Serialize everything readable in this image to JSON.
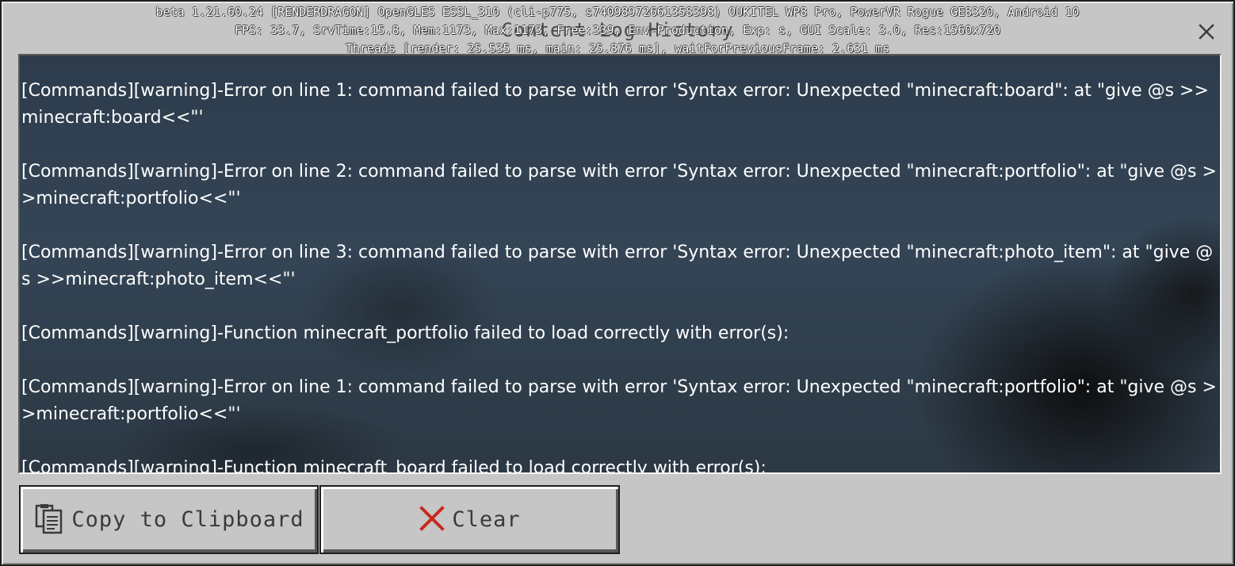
{
  "dialog": {
    "title": "Content Log History",
    "close_icon": "close-icon"
  },
  "debug_overlay": {
    "line1": "beta 1.21.60.24 [RENDERDRAGON] OpenGLES ESSL_310 (cli-p775, s74098972661358398) OUKITEL WP8 Pro, PowerVR Rogue GE8320, Android 10",
    "line2": "FPS: 33.7, SrvTime:15.8, Mem:1173, Max:1173, Free:339, Env-Production, Exp: s, GUI Scale: 3.0, Res:1560x720",
    "line3": "Threads [render: 25.535 ms, main: 25.876 ms], waitForPreviousFrame: 2.631 ms"
  },
  "log": {
    "entries": [
      "[Commands][warning]-Error on line 1: command failed to parse with error 'Syntax error: Unexpected \"minecraft:board\": at \"give @s >>minecraft:board<<\"'",
      "[Commands][warning]-Error on line 2: command failed to parse with error 'Syntax error: Unexpected \"minecraft:portfolio\": at \"give @s >>minecraft:portfolio<<\"'",
      "[Commands][warning]-Error on line 3: command failed to parse with error 'Syntax error: Unexpected \"minecraft:photo_item\": at \"give @s >>minecraft:photo_item<<\"'",
      "[Commands][warning]-Function minecraft_portfolio failed to load correctly with error(s):",
      "[Commands][warning]-Error on line 1: command failed to parse with error 'Syntax error: Unexpected \"minecraft:portfolio\": at \"give @s >>minecraft:portfolio<<\"'",
      "[Commands][warning]-Function minecraft_board failed to load correctly with error(s):"
    ]
  },
  "buttons": {
    "copy_label": "Copy to Clipboard",
    "copy_icon": "clipboard-icon",
    "clear_label": "Clear",
    "clear_icon": "x-icon",
    "clear_icon_color": "#c62a1e"
  }
}
